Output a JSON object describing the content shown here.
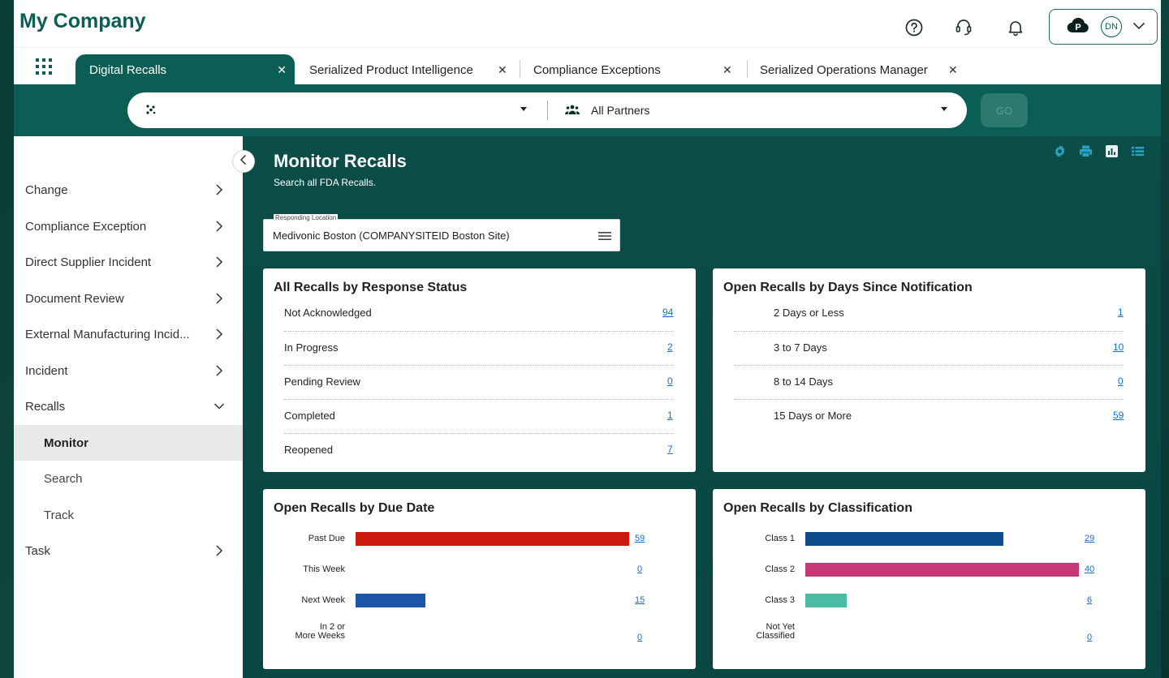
{
  "app": {
    "title": "My Company"
  },
  "header": {
    "help_icon": "help-circle-icon",
    "support_icon": "headset-icon",
    "notifications_icon": "bell-icon",
    "profile": {
      "cloud_letter": "P",
      "initials": "DN"
    }
  },
  "tabs": [
    {
      "label": "Digital Recalls",
      "active": true
    },
    {
      "label": "Serialized Product Intelligence",
      "active": false
    },
    {
      "label": "Compliance Exceptions",
      "active": false
    },
    {
      "label": "Serialized Operations Manager",
      "active": false
    }
  ],
  "search": {
    "left_value": "",
    "partner_value": "All Partners",
    "go_label": "GO"
  },
  "sidebar": {
    "items": [
      {
        "label": "Change",
        "type": "parent"
      },
      {
        "label": "Compliance Exception",
        "type": "parent"
      },
      {
        "label": "Direct Supplier Incident",
        "type": "parent"
      },
      {
        "label": "Document Review",
        "type": "parent"
      },
      {
        "label": "External Manufacturing Incid...",
        "type": "parent"
      },
      {
        "label": "Incident",
        "type": "parent"
      },
      {
        "label": "Recalls",
        "type": "expanded"
      },
      {
        "label": "Monitor",
        "type": "child-selected"
      },
      {
        "label": "Search",
        "type": "child"
      },
      {
        "label": "Track",
        "type": "child"
      },
      {
        "label": "Task",
        "type": "parent"
      }
    ]
  },
  "page": {
    "title": "Monitor Recalls",
    "subtitle": "Search all FDA Recalls.",
    "location_label": "Responding Location",
    "location_value": "Medivonic Boston (COMPANYSITEID Boston Site)"
  },
  "cards": {
    "response_status": {
      "title": "All Recalls by Response Status",
      "rows": [
        {
          "label": "Not Acknowledged",
          "value": "94"
        },
        {
          "label": "In Progress",
          "value": "2"
        },
        {
          "label": "Pending Review",
          "value": "0"
        },
        {
          "label": "Completed",
          "value": "1"
        },
        {
          "label": "Reopened",
          "value": "7"
        }
      ]
    },
    "days_since": {
      "title": "Open Recalls by Days Since Notification",
      "rows": [
        {
          "label": "2 Days or Less",
          "value": "1"
        },
        {
          "label": "3 to 7 Days",
          "value": "10"
        },
        {
          "label": "8 to 14 Days",
          "value": "0"
        },
        {
          "label": "15 Days or More",
          "value": "59"
        }
      ]
    },
    "due_date": {
      "title": "Open Recalls by Due Date",
      "max": 59,
      "rows": [
        {
          "label": "Past Due",
          "label2": "",
          "value": 59,
          "value_text": "59",
          "color": "#cc1a0e"
        },
        {
          "label": "This Week",
          "label2": "",
          "value": 0,
          "value_text": "0",
          "color": "#1c56a8"
        },
        {
          "label": "Next Week",
          "label2": "",
          "value": 15,
          "value_text": "15",
          "color": "#1c56a8"
        },
        {
          "label": "In 2 or",
          "label2": "More Weeks",
          "value": 0,
          "value_text": "0",
          "color": "#1c56a8"
        }
      ]
    },
    "classification": {
      "title": "Open Recalls by Classification",
      "max": 40,
      "rows": [
        {
          "label": "Class 1",
          "label2": "",
          "value": 29,
          "value_text": "29",
          "color": "#0e4d8c"
        },
        {
          "label": "Class 2",
          "label2": "",
          "value": 40,
          "value_text": "40",
          "color": "#c33a76"
        },
        {
          "label": "Class 3",
          "label2": "",
          "value": 6,
          "value_text": "6",
          "color": "#4cbba5"
        },
        {
          "label": "Not Yet",
          "label2": "Classified",
          "value": 0,
          "value_text": "0",
          "color": "#888888"
        }
      ]
    }
  },
  "colors": {
    "brand": "#0b5e53",
    "link": "#1a6ec7"
  }
}
